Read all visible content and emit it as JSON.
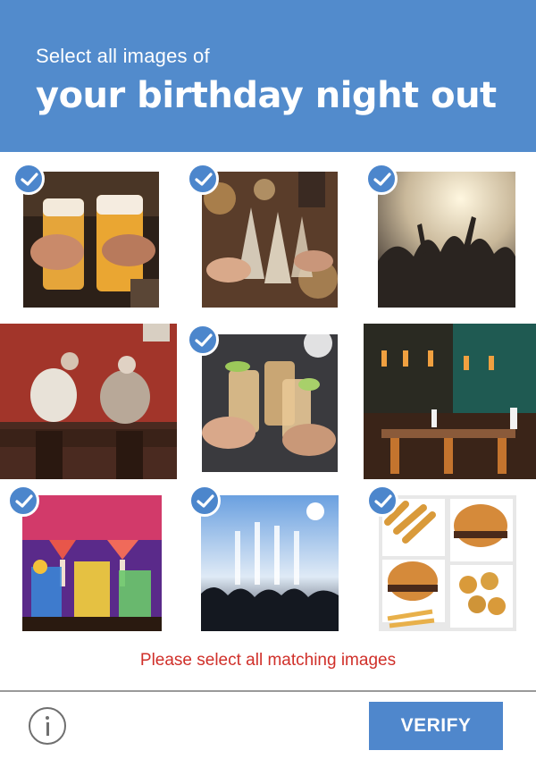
{
  "header": {
    "subtitle": "Select all images of",
    "title": "your birthday night out",
    "bg_color": "#528bcc"
  },
  "tiles": [
    {
      "id": 1,
      "content": "beer glasses toast",
      "selected": true
    },
    {
      "id": 2,
      "content": "champagne toast",
      "selected": true
    },
    {
      "id": 3,
      "content": "concert crowd",
      "selected": true
    },
    {
      "id": 4,
      "content": "elderly couple at restaurant table",
      "selected": false
    },
    {
      "id": 5,
      "content": "tequila shots toast",
      "selected": true
    },
    {
      "id": 6,
      "content": "empty restaurant interior",
      "selected": false
    },
    {
      "id": 7,
      "content": "colorful cocktails",
      "selected": true
    },
    {
      "id": 8,
      "content": "concert stage with fireworks",
      "selected": true
    },
    {
      "id": 9,
      "content": "burgers and fries",
      "selected": true
    }
  ],
  "icons": {
    "check": "checkmark-icon",
    "info": "info-icon"
  },
  "message": "Please select all matching images",
  "message_color": "#d0302a",
  "footer": {
    "verify_label": "VERIFY",
    "verify_color": "#4f87cc"
  }
}
